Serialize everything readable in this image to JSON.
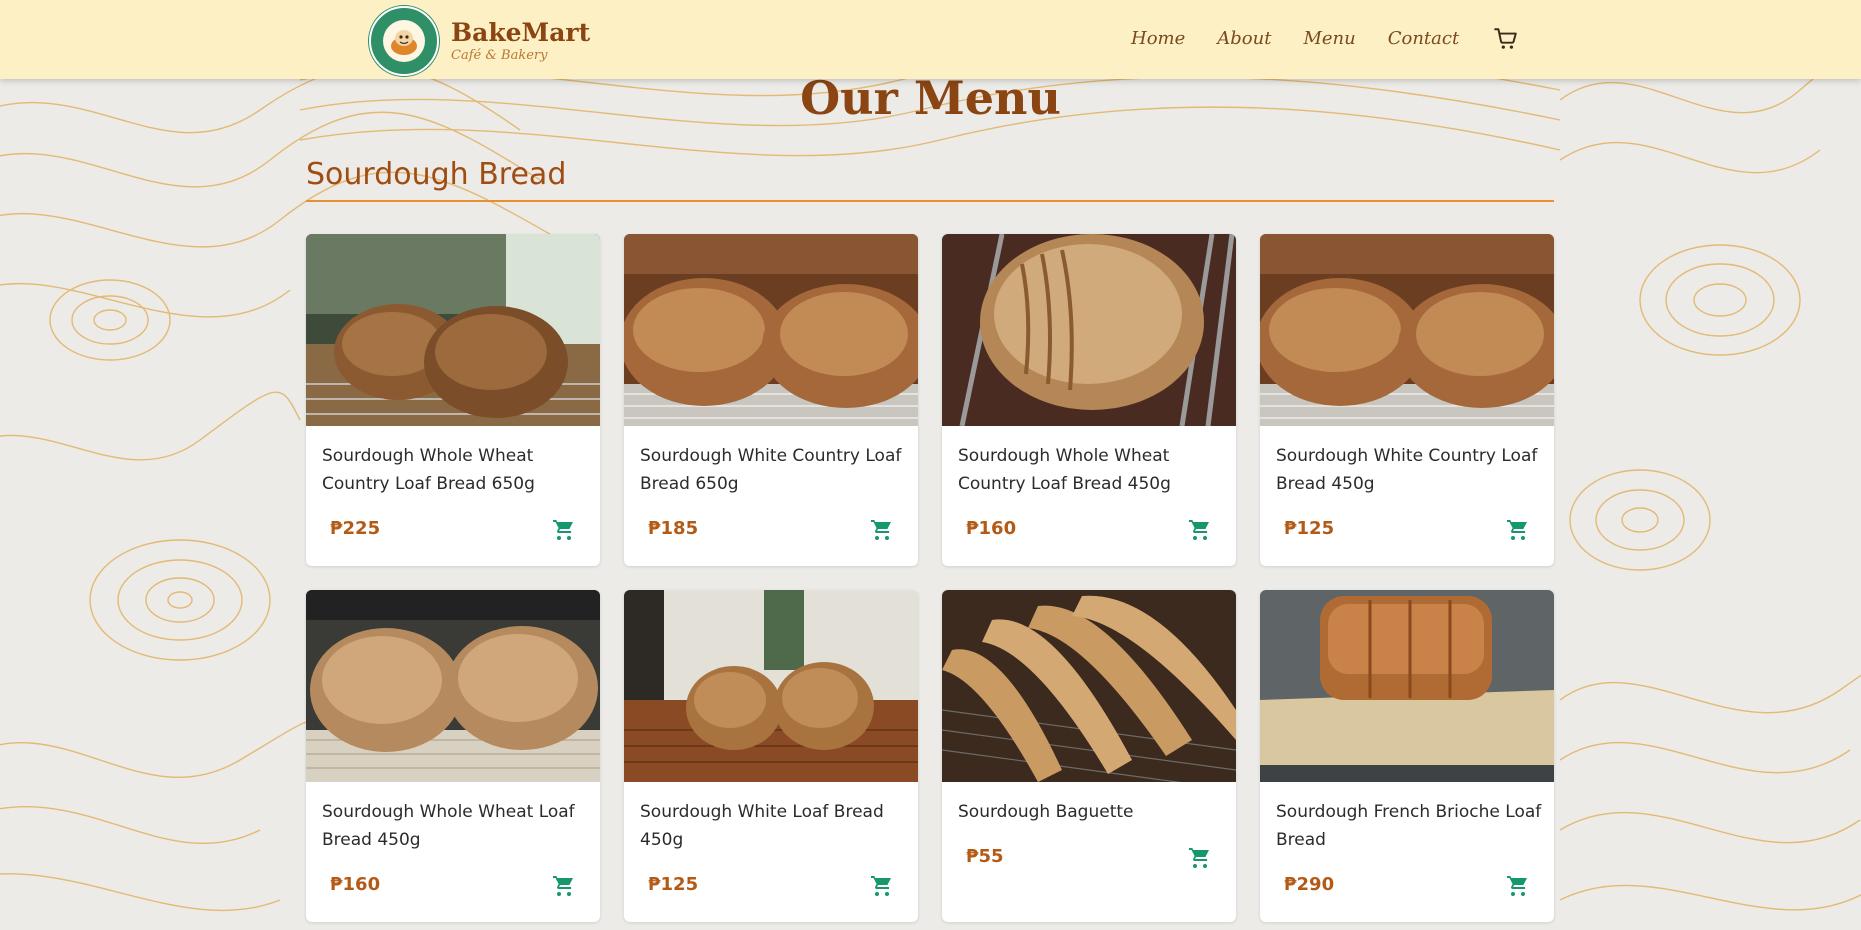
{
  "brand": {
    "name": "BakeMart",
    "subtitle": "Café & Bakery",
    "logo_text": "BAKEMART · CAFE AND BAKERY"
  },
  "nav": {
    "links": [
      "Home",
      "About",
      "Menu",
      "Contact"
    ],
    "cart_icon": "cart-icon"
  },
  "page": {
    "title": "Our Menu"
  },
  "section": {
    "title": "Sourdough Bread"
  },
  "colors": {
    "brand_brown": "#8a4513",
    "price": "#b35a17",
    "cart_green": "#17986a",
    "accent_orange": "#e8902f",
    "navbar_bg": "#fdf0c5"
  },
  "products": [
    {
      "name": "Sourdough Whole Wheat Country Loaf Bread 650g",
      "price": "₱225",
      "image": "two round dark loaves on wire rack"
    },
    {
      "name": "Sourdough White Country Loaf Bread 650g",
      "price": "₱185",
      "image": "two golden loaves on rack"
    },
    {
      "name": "Sourdough Whole Wheat Country Loaf Bread 450g",
      "price": "₱160",
      "image": "scored loaf on metal rack"
    },
    {
      "name": "Sourdough White Country Loaf Bread 450g",
      "price": "₱125",
      "image": "two golden loaves on rack"
    },
    {
      "name": "Sourdough Whole Wheat Loaf Bread 450g",
      "price": "₱160",
      "image": "two pale loaves on rack"
    },
    {
      "name": "Sourdough White Loaf Bread 450g",
      "price": "₱125",
      "image": "two small loaves on wooden board"
    },
    {
      "name": "Sourdough Baguette",
      "price": "₱55",
      "image": "baguettes on rack"
    },
    {
      "name": "Sourdough French Brioche Loaf Bread",
      "price": "₱290",
      "image": "brioche loaf on cutting board"
    }
  ]
}
